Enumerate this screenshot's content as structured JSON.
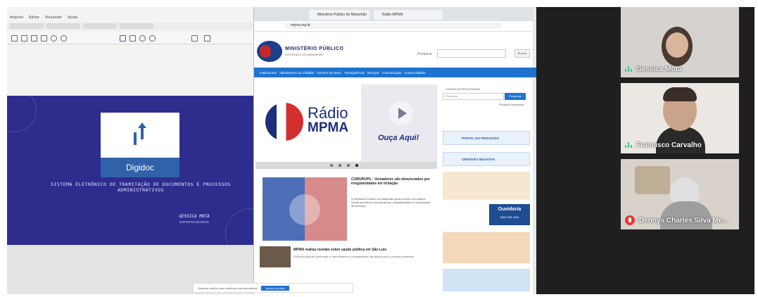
{
  "left_app": {
    "menu": [
      "Arquivo",
      "Editar",
      "Visualizar",
      "Ajuda"
    ],
    "slide": {
      "card_label": "Digidoc",
      "heading": "SISTEMA ELETRÔNICO DE TRAMITAÇÃO DE DOCUMENTOS E PROCESSOS ADMINISTRATIVOS",
      "author": "GESSICA MOTA",
      "author_role": "SUPORTE DIGIDOC"
    }
  },
  "browser": {
    "tabs": [
      "Ministério Público do Maranhão",
      "Rádio MPMA"
    ],
    "url": "mpma.mp.br",
    "site": {
      "name": "MINISTÉRIO PÚBLICO",
      "subtitle": "DO ESTADO DO MARANHÃO",
      "search_label": "Pesquisa",
      "search_button": "Buscar",
      "nav": [
        "Institucional",
        "Atendimento ao Cidadão",
        "Centros de Apoio",
        "Transparência",
        "Serviços",
        "Comunicação",
        "Acesso Rápido"
      ],
      "radio": {
        "title_1": "Rádio",
        "title_2": "MPMA",
        "cta": "Ouça Aqui!"
      },
      "news_1": {
        "title": "CURURUPU - Vereadores são denunciados por irregularidades em licitação",
        "body": "O Ministério Público do Maranhão ajuizou ação civil pública contra servidores municipais por irregularidades na contratação de serviços."
      },
      "news_2": {
        "title": "MPMA realiza reunião sobre saúde pública em São Luís",
        "body": "Encontro discutiu melhorias no atendimento e planejamento das ações para o próximo semestre."
      },
      "sidebar": {
        "heading": "CONSULTA PROCESSUAL",
        "search_placeholder": "Pesquisar",
        "search_button": "Pesquisar",
        "advanced_link": "Pesquisa Avançada",
        "banner_1": "PORTAL DO PROCESSO",
        "banner_2": "CERTIDÃO NEGATIVA",
        "ouvidoria": "Ouvidoria",
        "ouvidoria_phone": "0800 098 1600"
      },
      "cookie": {
        "text": "Usamos cookies para melhorar sua experiência",
        "accept": "Aceitar cookies"
      }
    }
  },
  "participants": [
    {
      "name": "Gessica Mota",
      "audio": "speaking"
    },
    {
      "name": "Francisco Carvalho",
      "audio": "speaking"
    },
    {
      "name": "Dennys Charles Silva Me...",
      "audio": "muted"
    }
  ],
  "colors": {
    "slide_bg": "#2e2d8e",
    "nav_blue": "#1e73d0",
    "brand_navy": "#1b2f7a",
    "brand_red": "#d32f2f",
    "speaking_green": "#35d07f",
    "muted_red": "#e53935"
  }
}
